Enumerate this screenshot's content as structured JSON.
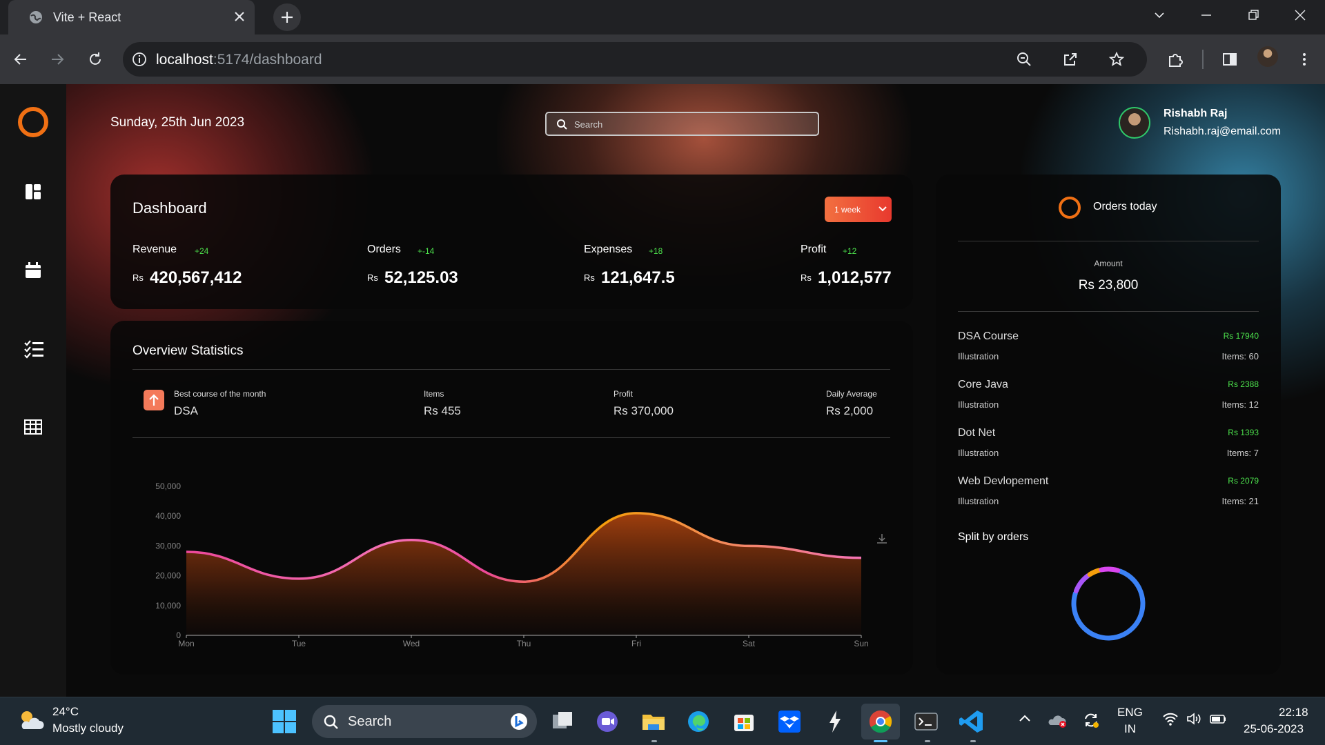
{
  "browser": {
    "tab_title": "Vite + React",
    "url_host": "localhost",
    "url_path": ":5174/dashboard"
  },
  "header": {
    "date": "Sunday, 25th Jun 2023",
    "search_placeholder": "Search",
    "user_name": "Rishabh Raj",
    "user_email": "Rishabh.raj@email.com"
  },
  "sidebar": {
    "icons": [
      "dashboard-icon",
      "calendar-icon",
      "checklist-icon",
      "table-icon"
    ]
  },
  "dashboard": {
    "title": "Dashboard",
    "period": "1 week",
    "currency": "Rs",
    "stats": [
      {
        "label": "Revenue",
        "change": "+24",
        "value": "420,567,412"
      },
      {
        "label": "Orders",
        "change": "+-14",
        "value": "52,125.03"
      },
      {
        "label": "Expenses",
        "change": "+18",
        "value": "121,647.5"
      },
      {
        "label": "Profit",
        "change": "+12",
        "value": "1,012,577"
      }
    ]
  },
  "overview": {
    "title": "Overview Statistics",
    "best_label": "Best course of the month",
    "best_value": "DSA",
    "items_label": "Items",
    "items_value": "Rs 455",
    "profit_label": "Profit",
    "profit_value": "Rs 370,000",
    "avg_label": "Daily Average",
    "avg_value": "Rs 2,000"
  },
  "chart_data": {
    "type": "area",
    "categories": [
      "Mon",
      "Tue",
      "Wed",
      "Thu",
      "Fri",
      "Sat",
      "Sun"
    ],
    "values": [
      28000,
      19000,
      32000,
      18000,
      41000,
      30000,
      26000
    ],
    "ylim": [
      0,
      50000
    ],
    "yticks": [
      "0",
      "10,000",
      "20,000",
      "30,000",
      "40,000",
      "50,000"
    ],
    "line_colors": [
      "#ec4899",
      "#f59e0b"
    ],
    "grid": false
  },
  "orders_panel": {
    "title": "Orders today",
    "amount_label": "Amount",
    "amount_value": "Rs 23,800",
    "items": [
      {
        "name": "DSA Course",
        "price": "Rs 17940",
        "category": "Illustration",
        "items": "Items: 60"
      },
      {
        "name": "Core Java",
        "price": "Rs 2388",
        "category": "Illustration",
        "items": "Items: 12"
      },
      {
        "name": "Dot Net",
        "price": "Rs 1393",
        "category": "Illustration",
        "items": "Items: 7"
      },
      {
        "name": "Web Devlopement",
        "price": "Rs 2079",
        "category": "Illustration",
        "items": "Items: 21"
      }
    ],
    "split_title": "Split by orders",
    "split_data": {
      "type": "pie",
      "values": [
        17940,
        2388,
        1393,
        2079
      ],
      "colors": [
        "#3b82f6",
        "#a855f7",
        "#f59e0b",
        "#d946ef"
      ]
    }
  },
  "taskbar": {
    "temp": "24°C",
    "weather": "Mostly cloudy",
    "search": "Search",
    "lang1": "ENG",
    "lang2": "IN",
    "time": "22:18",
    "date": "25-06-2023"
  }
}
